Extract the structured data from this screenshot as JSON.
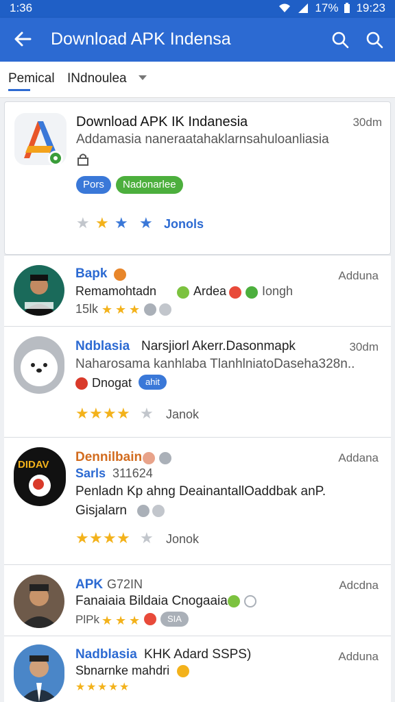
{
  "status": {
    "time": "1:36",
    "battery": "17%",
    "clock": "19:23"
  },
  "appbar": {
    "title": "Download APK Indensa"
  },
  "filters": {
    "primary": "Pemical",
    "secondary": "INdnoulea"
  },
  "featured": {
    "title": "Download APK IK Indanesia",
    "time": "30dm",
    "subtitle": "Addamasia naneraatahaklarnsahuloanliasia",
    "chip1": "Pors",
    "chip2": "Nadonarlee",
    "rating_label": "Jonols",
    "stars": [
      "grey",
      "gold",
      "blue",
      "blue"
    ]
  },
  "items": [
    {
      "name": "Bapk",
      "time": "Adduna",
      "line1": "Remamohtadn",
      "line1b": "Ardea",
      "line1c": "Iongh",
      "downloads": "15lk",
      "stars": 3
    },
    {
      "name": "Ndblasia",
      "name2": "Narsjiorl Akerr.Dasonmapk",
      "time": "30dm",
      "line1": "Naharosama kanhlaba TlanhlniatoDaseha328n..",
      "line2": "Dnogat",
      "chip": "ahit",
      "rating_label": "Janok",
      "stars": 4
    },
    {
      "name": "Dennilbain",
      "time": "Addana",
      "sub": "Sarls",
      "sub_num": "311624",
      "line1": "Penladn Kp ahng DeainantallOaddbak anP.",
      "line2": "Gisjalarn",
      "rating_label": "Jonok",
      "stars": 4
    },
    {
      "name": "APK",
      "name_code": "G72IN",
      "time": "Adcdna",
      "line1": "Fanaiaia Bildaia Cnogaaia",
      "downloads": "PlPk",
      "chip": "SIA",
      "stars": 3
    },
    {
      "name": "Nadblasia",
      "name2": "KHK Adard SSPS)",
      "time": "Adduna",
      "line1": "Sbnarnke mahdri",
      "stars": 5
    }
  ],
  "colors": {
    "appbar": "#2c6ad2",
    "statusbar": "#1f5fc6",
    "chip_blue": "#3a78d8",
    "chip_green": "#4caf3d",
    "star_gold": "#f3b21b"
  }
}
